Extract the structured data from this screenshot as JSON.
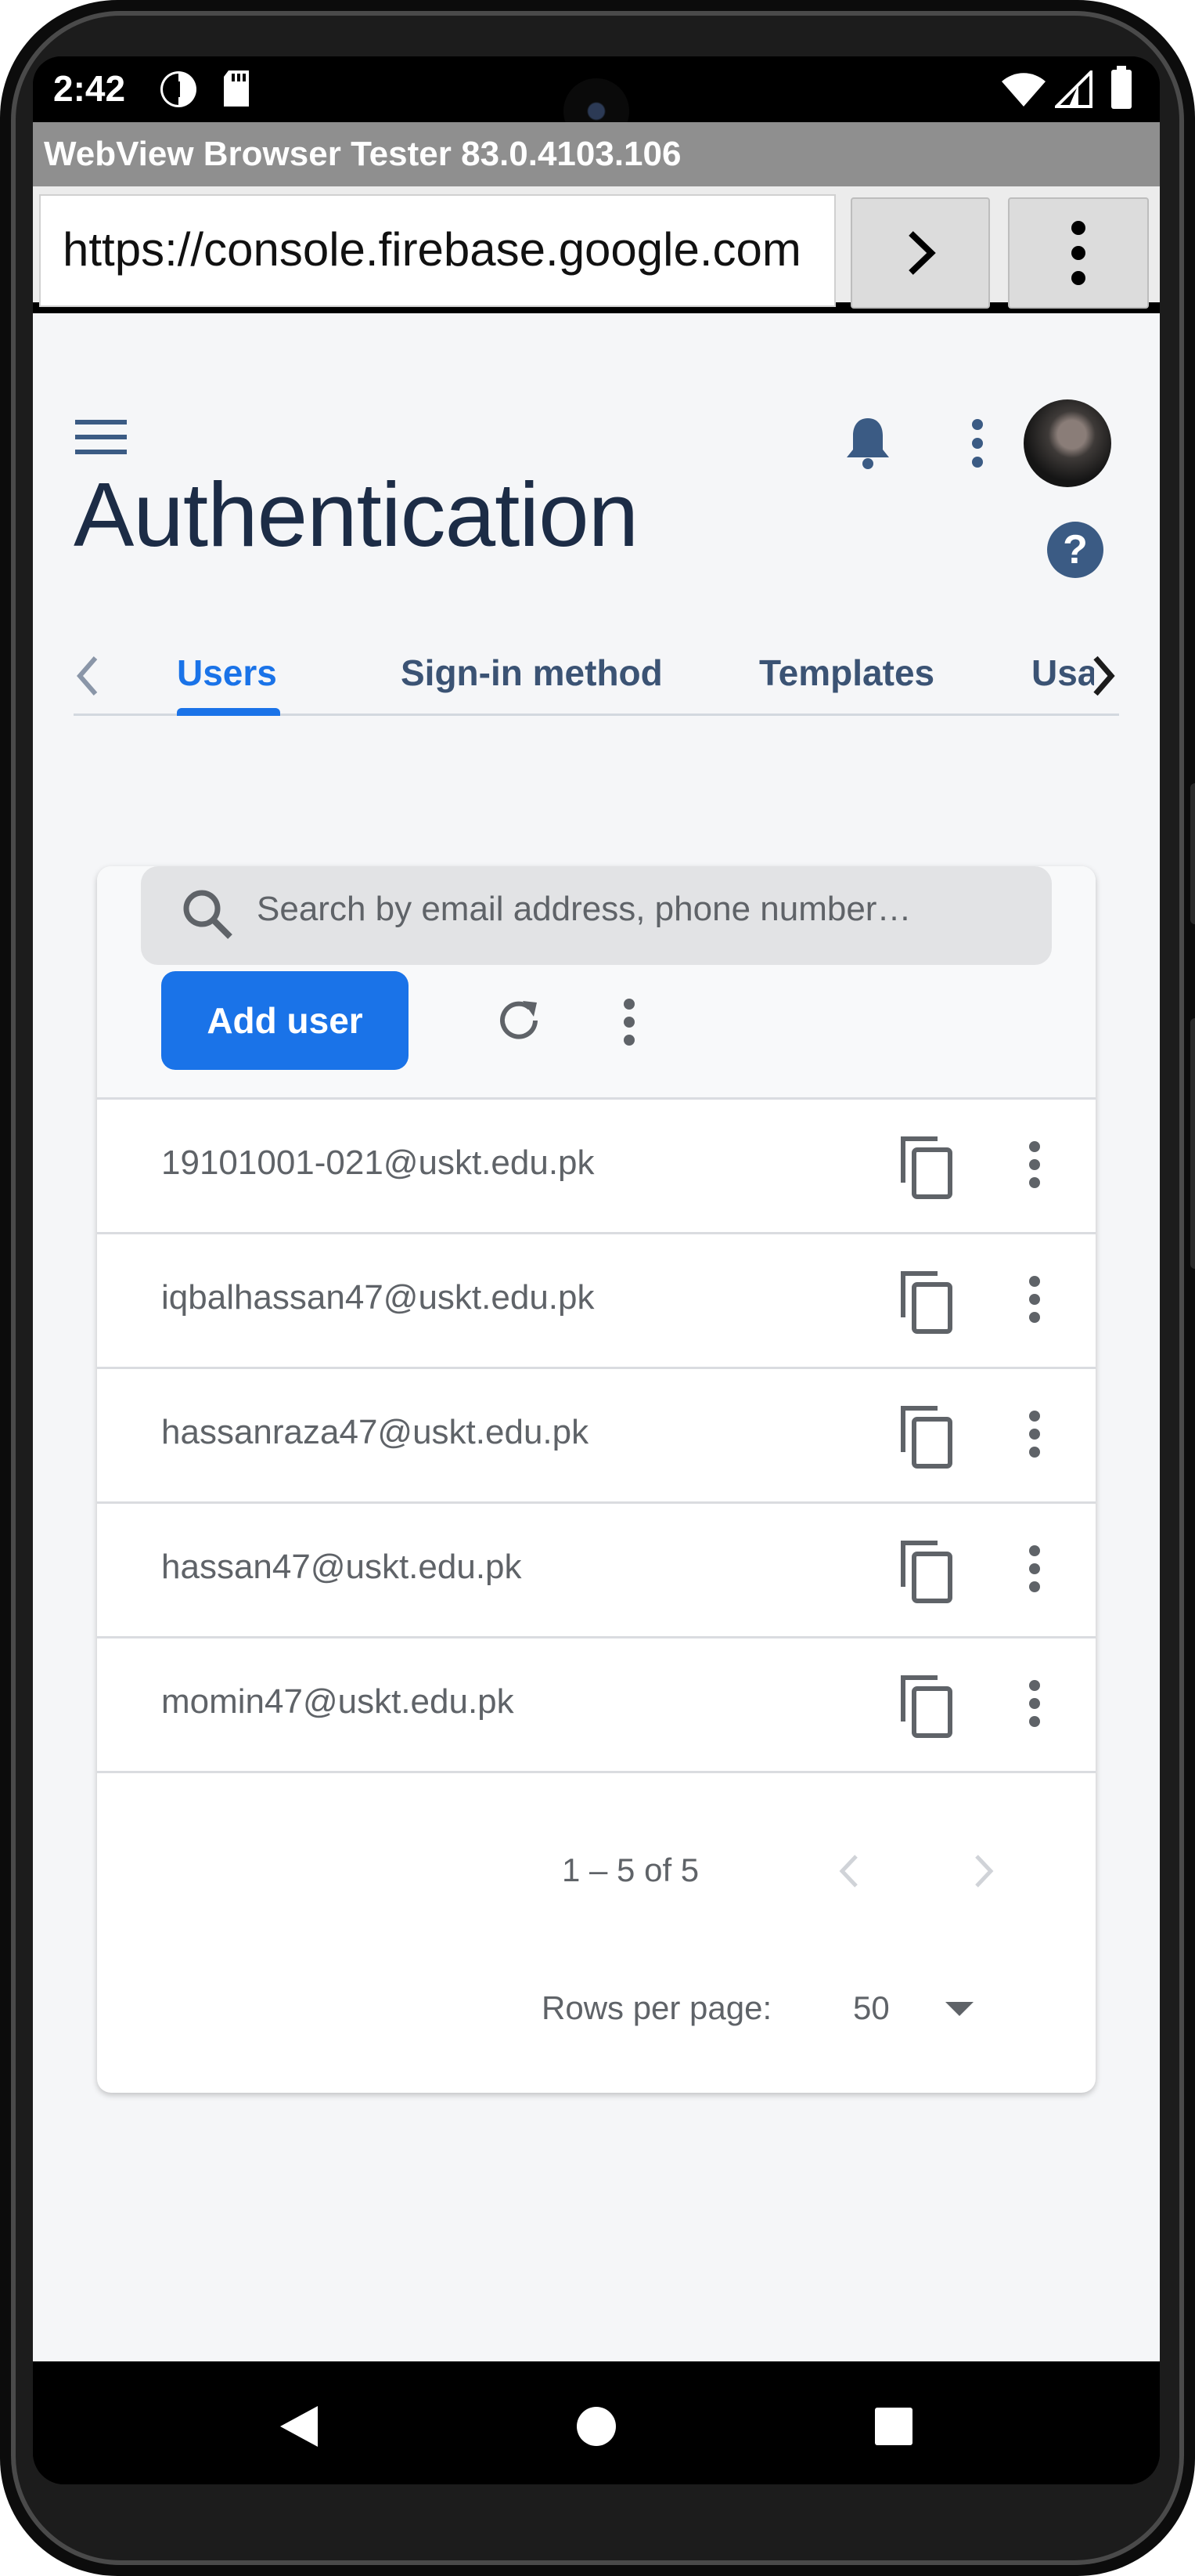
{
  "status_bar": {
    "time": "2:42",
    "icons": [
      "notification-app-icon",
      "sd-card-icon",
      "wifi-icon",
      "signal-icon",
      "battery-icon"
    ]
  },
  "webview": {
    "title": "WebView Browser Tester 83.0.4103.106",
    "url": "https://console.firebase.google.com",
    "go_icon": "chevron-right-icon",
    "menu_icon": "more-vert-icon"
  },
  "page": {
    "title": "Authentication",
    "tabs": [
      {
        "label": "Users",
        "active": true
      },
      {
        "label": "Sign-in method",
        "active": false
      },
      {
        "label": "Templates",
        "active": false
      },
      {
        "label": "Usa",
        "active": false
      }
    ],
    "search_placeholder": "Search by email address, phone number…",
    "add_user_label": "Add user",
    "users": [
      {
        "email": "19101001-021@uskt.edu.pk"
      },
      {
        "email": "iqbalhassan47@uskt.edu.pk"
      },
      {
        "email": "hassanraza47@uskt.edu.pk"
      },
      {
        "email": "hassan47@uskt.edu.pk"
      },
      {
        "email": "momin47@uskt.edu.pk"
      }
    ],
    "pagination": {
      "range": "1 – 5 of 5",
      "rows_label": "Rows per page:",
      "rows_value": "50"
    }
  },
  "colors": {
    "accent": "#1a73e8",
    "title_text": "#1c2c46",
    "tab_text": "#3b5374",
    "page_bg": "#f5f6f8"
  }
}
